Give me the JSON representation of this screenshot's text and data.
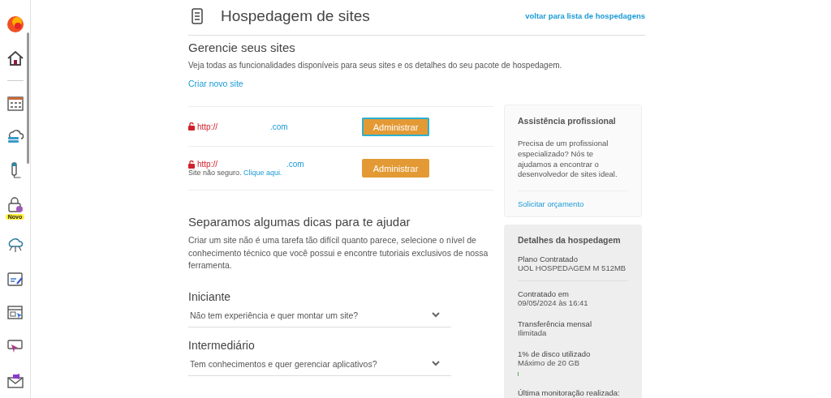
{
  "sidebar": {
    "badge": "Novo"
  },
  "header": {
    "title": "Hospedagem de sites",
    "back_link": "voltar para lista de hospedagens"
  },
  "manage": {
    "title": "Gerencie seus sites",
    "description": "Veja todas as funcionalidades disponíveis para seus sites e os detalhes do seu pacote de hospedagem.",
    "create_link": "Criar novo site"
  },
  "sites": [
    {
      "protocol": "http://",
      "domain": ".com",
      "button": "Administrar",
      "focused": true
    },
    {
      "protocol": "http://",
      "domain": ".com",
      "warning": "Site não seguro.",
      "warning_link": "Clique aqui.",
      "button": "Administrar",
      "focused": false
    }
  ],
  "tips": {
    "title": "Separamos algumas dicas para te ajudar",
    "text": "Criar um site não é uma tarefa tão difícil quanto parece, selecione o nível de conhecimento técnico que você possui e encontre tutoriais exclusivos de nossa ferramenta.",
    "levels": [
      {
        "title": "Iniciante",
        "question": "Não tem experiência e quer montar um site?",
        "expanded": false
      },
      {
        "title": "Intermediário",
        "question": "Tem conhecimentos e quer gerenciar aplicativos?",
        "expanded": false
      }
    ]
  },
  "assistance": {
    "title": "Assistência profissional",
    "text": "Precisa de um profissional especializado? Nós te ajudamos a encontrar o desenvolvedor de sites ideal.",
    "link": "Solicitar orçamento"
  },
  "details": {
    "title": "Detalhes da hospedagem",
    "items": [
      {
        "label": "Plano Contratado",
        "value": "UOL HOSPEDAGEM M 512MB",
        "kind": "text"
      },
      {
        "label": "Contratado em",
        "value": "09/05/2024 às 16:41",
        "kind": "text"
      },
      {
        "label": "Transferência mensal",
        "value": "Ilimitada",
        "kind": "text"
      },
      {
        "label": "1% de disco utilizado",
        "value": "Máximo de 20 GB",
        "kind": "meter"
      },
      {
        "label": "Última monitoração realizada:",
        "kind": "text"
      }
    ]
  }
}
